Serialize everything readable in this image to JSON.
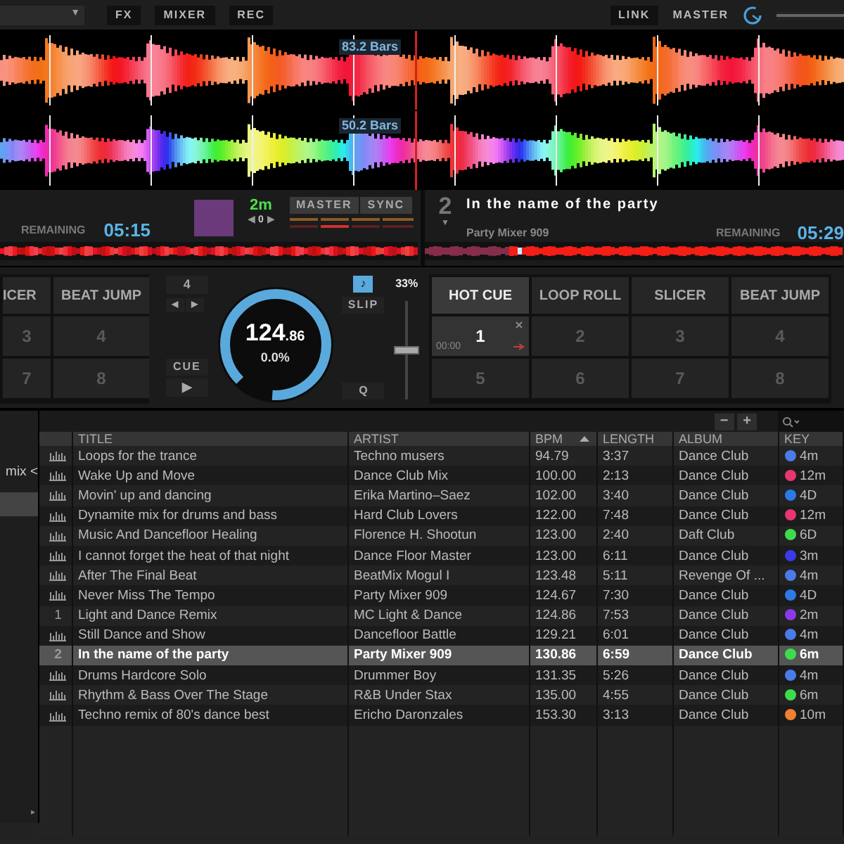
{
  "top_bar": {
    "dropdown_arrow": "▼",
    "buttons": [
      "FX",
      "MIXER",
      "REC"
    ],
    "link": "LINK",
    "master": "MASTER",
    "master_volume": {
      "level": 1
    }
  },
  "waveforms": [
    {
      "bars_label": "83.2 Bars"
    },
    {
      "bars_label": "50.2 Bars"
    }
  ],
  "deck_1": {
    "remaining_label": "REMAINING",
    "remaining": "05:15",
    "key": "2m",
    "key_shift": {
      "left": "◀",
      "value": "0",
      "right": "▶"
    },
    "master": "MASTER",
    "sync": "SYNC",
    "pad_modes": [
      {
        "label": "ICER",
        "selected": false
      },
      {
        "label": "BEAT JUMP",
        "selected": false
      }
    ],
    "pads": [
      "3",
      "4",
      "7",
      "8"
    ],
    "loop_size": "4",
    "loop_left": "◀",
    "loop_right": "▶",
    "cue": "CUE",
    "play": "▶",
    "bpm": "124",
    "bpm_fraction": ".86",
    "pitch": "0.0%",
    "keylock": {
      "label": "♪",
      "on": true
    },
    "slip": "SLIP",
    "quantize": "Q",
    "pitch_range": "33%",
    "pitch_fader": {
      "level": 0.5
    }
  },
  "deck_2": {
    "number": "2",
    "menu_arrow": "▼",
    "title": "In the name of the party",
    "artist": "Party Mixer 909",
    "remaining_label": "REMAINING",
    "remaining": "05:29",
    "pad_modes": [
      {
        "label": "HOT CUE",
        "selected": true
      },
      {
        "label": "LOOP ROLL",
        "selected": false
      },
      {
        "label": "SLICER",
        "selected": false
      },
      {
        "label": "BEAT JUMP",
        "selected": false
      }
    ],
    "pads": [
      {
        "label": "1",
        "time": "00:00",
        "set": true
      },
      {
        "label": "2",
        "set": false
      },
      {
        "label": "3",
        "set": false
      },
      {
        "label": "4",
        "set": false
      },
      {
        "label": "5",
        "set": false
      },
      {
        "label": "6",
        "set": false
      },
      {
        "label": "7",
        "set": false
      },
      {
        "label": "8",
        "set": false
      }
    ]
  },
  "browser": {
    "sidebar": {
      "items": [
        {
          "label": "mix <"
        }
      ],
      "scroll_arrow": "▸"
    },
    "toolbar": {
      "buttons": [
        "−",
        "+"
      ]
    },
    "columns": [
      {
        "label": "TITLE",
        "sorted": false
      },
      {
        "label": "ARTIST",
        "sorted": false
      },
      {
        "label": "BPM",
        "sorted": true
      },
      {
        "label": "LENGTH",
        "sorted": false
      },
      {
        "label": "ALBUM",
        "sorted": false
      },
      {
        "label": "KEY",
        "sorted": false
      }
    ],
    "rows": [
      {
        "title": "Loops for the trance",
        "artist": "Techno musers",
        "bpm": "94.79",
        "length": "3:37",
        "album": "Dance Club",
        "key": "4m",
        "color": "#4a7be8",
        "selected": false
      },
      {
        "title": "Wake Up and Move",
        "artist": "Dance Club Mix",
        "bpm": "100.00",
        "length": "2:13",
        "album": "Dance Club",
        "key": "12m",
        "color": "#e8366f",
        "selected": false
      },
      {
        "title": "Movin' up and dancing",
        "artist": "Erika Martino–Saez",
        "bpm": "102.00",
        "length": "3:40",
        "album": "Dance Club",
        "key": "4D",
        "color": "#2b7ae8",
        "selected": false
      },
      {
        "title": "Dynamite mix for drums and bass",
        "artist": "Hard Club Lovers",
        "bpm": "122.00",
        "length": "7:48",
        "album": "Dance Club",
        "key": "12m",
        "color": "#e8366f",
        "selected": false
      },
      {
        "title": "Music And Dancefloor Healing",
        "artist": "Florence H. Shootun",
        "bpm": "123.00",
        "length": "2:40",
        "album": "Daft Club",
        "key": "6D",
        "color": "#3ddc4c",
        "selected": false
      },
      {
        "title": "I cannot forget the heat of that night",
        "artist": "Dance Floor Master",
        "bpm": "123.00",
        "length": "6:11",
        "album": "Dance Club",
        "key": "3m",
        "color": "#3a3ae8",
        "selected": false
      },
      {
        "title": "After The Final Beat",
        "artist": "BeatMix Mogul I",
        "bpm": "123.48",
        "length": "5:11",
        "album": "Revenge Of ...",
        "key": "4m",
        "color": "#4a7be8",
        "selected": false
      },
      {
        "title": "Never Miss The Tempo",
        "artist": "Party Mixer 909",
        "bpm": "124.67",
        "length": "7:30",
        "album": "Dance Club",
        "key": "4D",
        "color": "#2b7ae8",
        "selected": false
      },
      {
        "deck": "1",
        "title": "Light and Dance Remix",
        "artist": "MC Light & Dance",
        "bpm": "124.86",
        "length": "7:53",
        "album": "Dance Club",
        "key": "2m",
        "color": "#8a3ae8",
        "selected": false
      },
      {
        "title": "Still Dance and Show",
        "artist": "Dancefloor Battle",
        "bpm": "129.21",
        "length": "6:01",
        "album": "Dance Club",
        "key": "4m",
        "color": "#4a7be8",
        "selected": false
      },
      {
        "deck": "2",
        "title": "In the name of the party",
        "artist": "Party Mixer 909",
        "bpm": "130.86",
        "length": "6:59",
        "album": "Dance Club",
        "key": "6m",
        "color": "#3ddc4c",
        "selected": true
      },
      {
        "title": "Drums Hardcore Solo",
        "artist": "Drummer Boy",
        "bpm": "131.35",
        "length": "5:26",
        "album": "Dance Club",
        "key": "4m",
        "color": "#4a7be8",
        "selected": false
      },
      {
        "title": "Rhythm & Bass Over The Stage",
        "artist": "R&B Under Stax",
        "bpm": "135.00",
        "length": "4:55",
        "album": "Dance Club",
        "key": "6m",
        "color": "#3ddc4c",
        "selected": false
      },
      {
        "title": "Techno remix of 80's dance best",
        "artist": "Ericho Daronzales",
        "bpm": "153.30",
        "length": "3:13",
        "album": "Dance Club",
        "key": "10m",
        "color": "#f08030",
        "selected": false
      }
    ]
  }
}
